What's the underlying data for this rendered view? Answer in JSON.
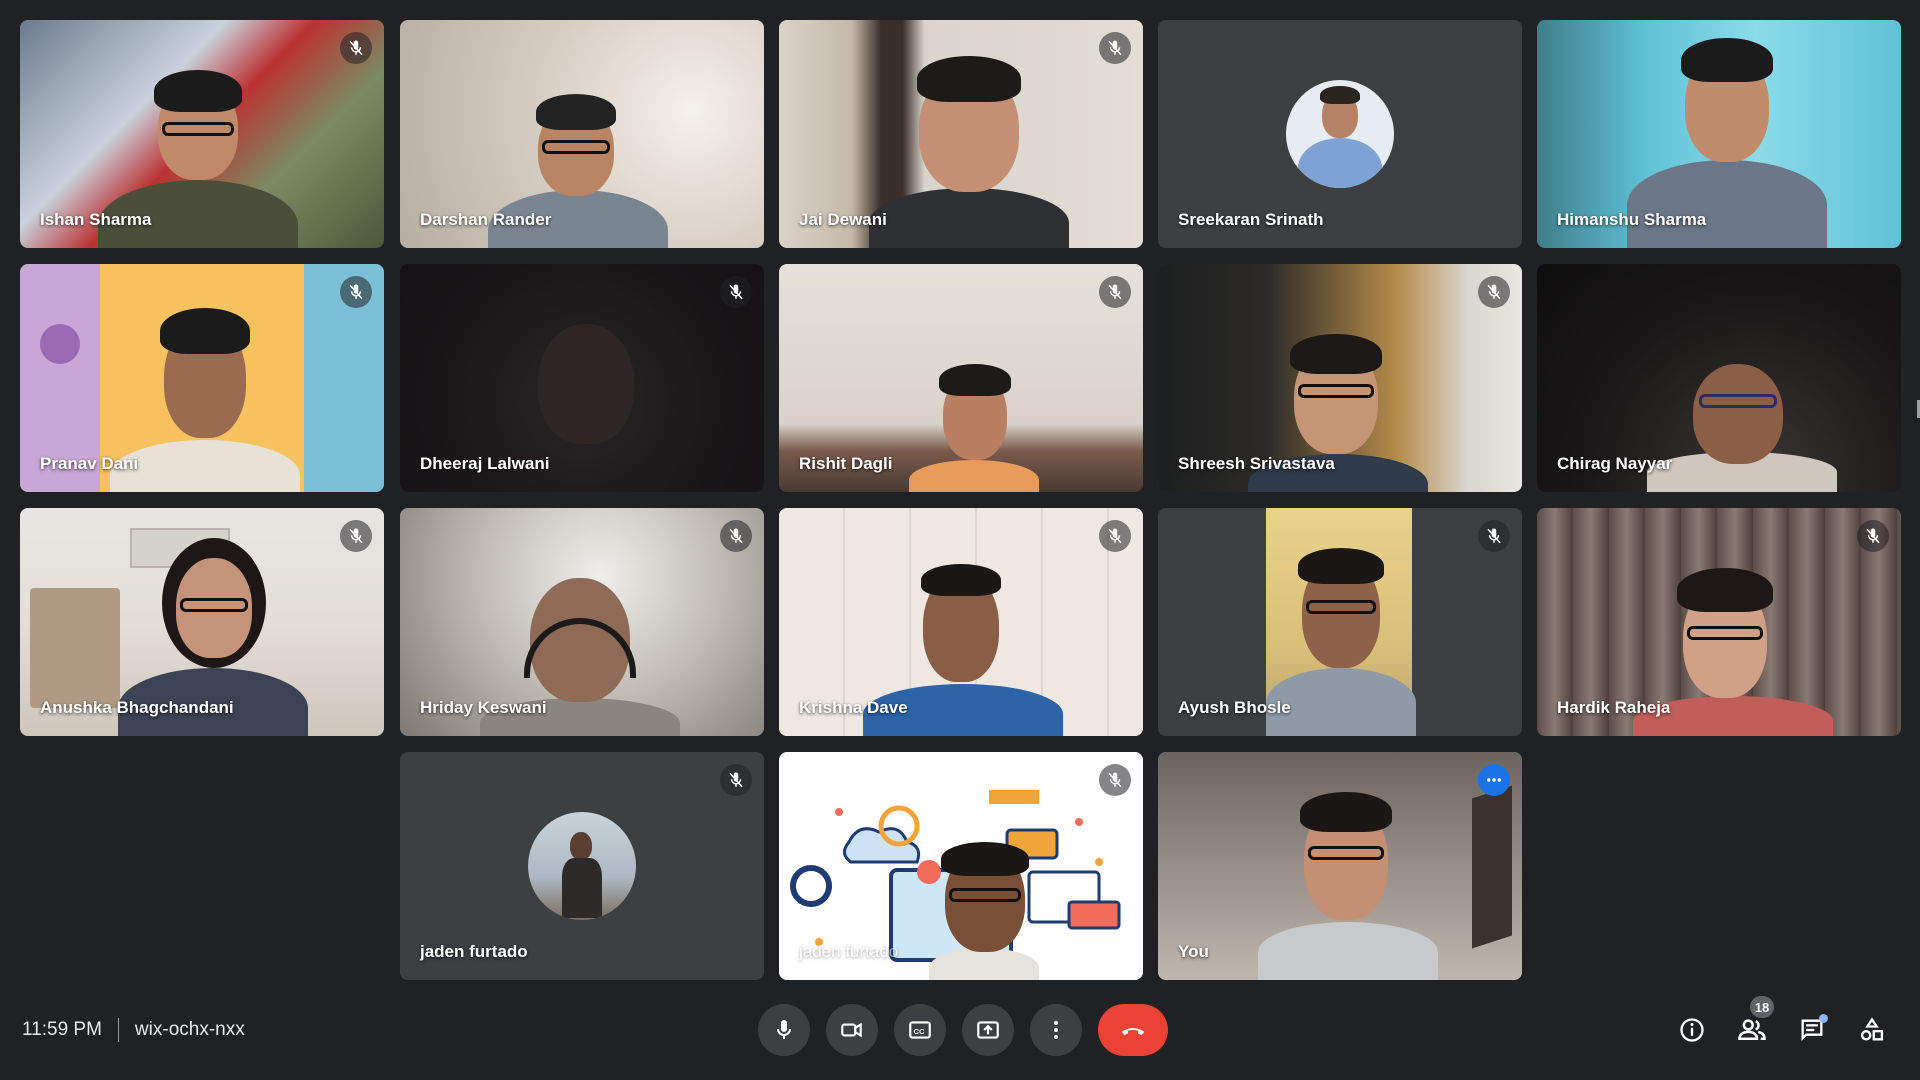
{
  "colors": {
    "background": "#202124",
    "tile_placeholder": "#3c4043",
    "accent_blue": "#1a73e8",
    "active_outline": "#8ab4f8",
    "end_call_red": "#ea4335"
  },
  "participants": [
    {
      "name": "Ishan Sharma",
      "muted": true
    },
    {
      "name": "Darshan Rander",
      "muted": false
    },
    {
      "name": "Jai Dewani",
      "muted": true
    },
    {
      "name": "Sreekaran Srinath",
      "muted": false,
      "avatar": true
    },
    {
      "name": "Himanshu Sharma",
      "muted": false
    },
    {
      "name": "Pranav Dani",
      "muted": true
    },
    {
      "name": "Dheeraj Lalwani",
      "muted": true
    },
    {
      "name": "Rishit Dagli",
      "muted": true
    },
    {
      "name": "Shreesh Srivastava",
      "muted": true
    },
    {
      "name": "Chirag Nayyar",
      "muted": false
    },
    {
      "name": "Anushka Bhagchandani",
      "muted": true
    },
    {
      "name": "Hriday Keswani",
      "muted": true
    },
    {
      "name": "Krishna Dave",
      "muted": true
    },
    {
      "name": "Ayush Bhosle",
      "muted": true
    },
    {
      "name": "Hardik Raheja",
      "muted": true
    },
    {
      "name": "jaden furtado",
      "muted": true,
      "avatar": true
    },
    {
      "name": "jaden furtado",
      "muted": true,
      "presenting": true
    },
    {
      "name": "You",
      "muted": false,
      "self": true
    }
  ],
  "meeting": {
    "time": "11:59 PM",
    "code": "wix-ochx-nxx",
    "participant_count": "18"
  },
  "controls": {
    "microphone": "mic-icon",
    "camera": "camera-icon",
    "captions": "captions-icon",
    "present": "present-screen-icon",
    "more": "more-options-icon",
    "leave": "end-call-icon"
  },
  "side_controls": {
    "info": "info-icon",
    "people": "people-icon",
    "chat": "chat-icon",
    "activities": "activities-icon"
  }
}
